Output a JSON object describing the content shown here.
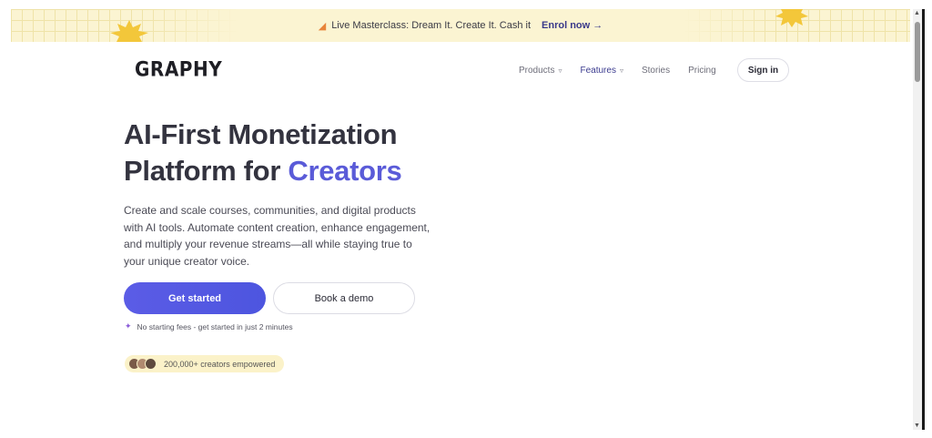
{
  "banner": {
    "text": "Live Masterclass: Dream It. Create It. Cash it",
    "link": "Enrol now →"
  },
  "brand": {
    "logo": "GRAPHY"
  },
  "nav": {
    "products": "Products",
    "features": "Features",
    "stories": "Stories",
    "pricing": "Pricing",
    "signin": "Sign in"
  },
  "hero": {
    "title_line1": "AI-First Monetization",
    "title_line2_plain": "Platform for ",
    "title_line2_accent": "Creators",
    "description": "Create and scale courses, communities, and digital products with AI tools. Automate content creation, enhance engagement, and multiply your revenue streams—all while staying true to your unique creator voice.",
    "primary_cta": "Get started",
    "secondary_cta": "Book a demo",
    "note": "No starting fees - get started in just 2 minutes",
    "creators": "200,000+ creators empowered"
  },
  "colors": {
    "accent": "#5a5bd8",
    "banner_bg": "#fbf4d2",
    "pill_bg": "#fbf2c9"
  },
  "icons": {
    "banner_flag": "megaphone-icon",
    "chevron": "chevron-down-icon",
    "note": "sparkle-icon"
  }
}
